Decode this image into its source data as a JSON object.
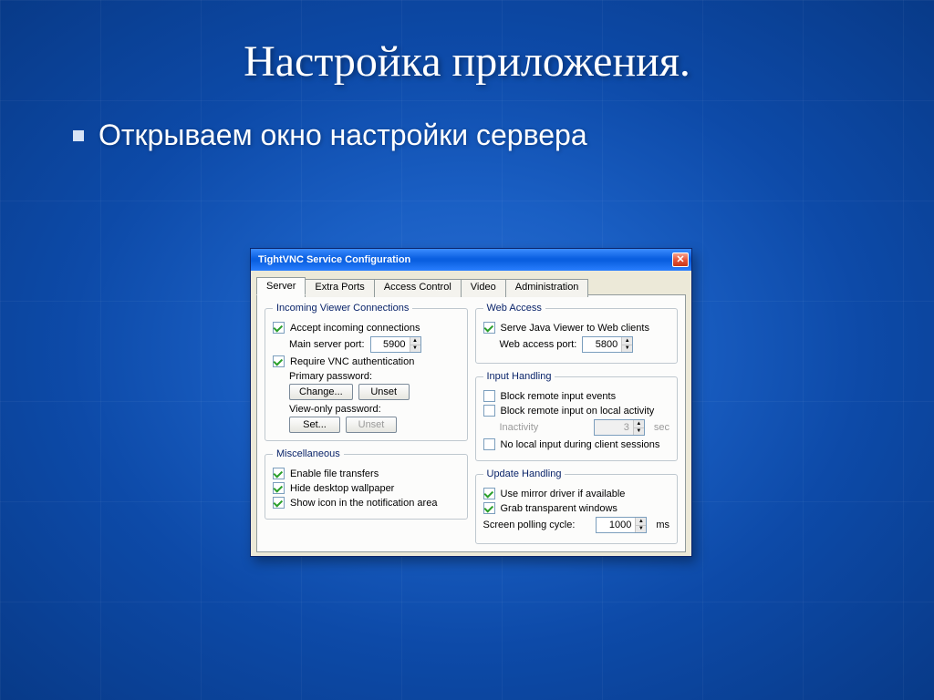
{
  "slide": {
    "title": "Настройка приложения.",
    "bullet": "Открываем окно настройки сервера"
  },
  "window": {
    "title": "TightVNC Service Configuration",
    "tabs": [
      "Server",
      "Extra Ports",
      "Access Control",
      "Video",
      "Administration"
    ],
    "activeTab": 0
  },
  "incoming": {
    "legend": "Incoming Viewer Connections",
    "accept": {
      "checked": true,
      "label": "Accept incoming connections"
    },
    "portLabel": "Main server port:",
    "portValue": "5900",
    "requireAuth": {
      "checked": true,
      "label": "Require VNC authentication"
    },
    "primaryPwdLabel": "Primary password:",
    "changeBtn": "Change...",
    "unsetBtn": "Unset",
    "viewOnlyLabel": "View-only password:",
    "setBtn": "Set...",
    "unsetBtn2": "Unset"
  },
  "misc": {
    "legend": "Miscellaneous",
    "fileTransfers": {
      "checked": true,
      "label": "Enable file transfers"
    },
    "hideWallpaper": {
      "checked": true,
      "label": "Hide desktop wallpaper"
    },
    "showIcon": {
      "checked": true,
      "label": "Show icon in the notification area"
    }
  },
  "web": {
    "legend": "Web Access",
    "serveJava": {
      "checked": true,
      "label": "Serve Java Viewer to Web clients"
    },
    "portLabel": "Web access port:",
    "portValue": "5800"
  },
  "input": {
    "legend": "Input Handling",
    "blockRemote": {
      "checked": false,
      "label": "Block remote input events"
    },
    "blockOnLocal": {
      "checked": false,
      "label": "Block remote input on local activity"
    },
    "inactivityLabel": "Inactivity",
    "inactivityValue": "3",
    "inactivityUnit": "sec",
    "noLocal": {
      "checked": false,
      "label": "No local input during client sessions"
    }
  },
  "update": {
    "legend": "Update Handling",
    "mirror": {
      "checked": true,
      "label": "Use mirror driver if available"
    },
    "transparent": {
      "checked": true,
      "label": "Grab transparent windows"
    },
    "pollingLabel": "Screen polling cycle:",
    "pollingValue": "1000",
    "pollingUnit": "ms"
  }
}
